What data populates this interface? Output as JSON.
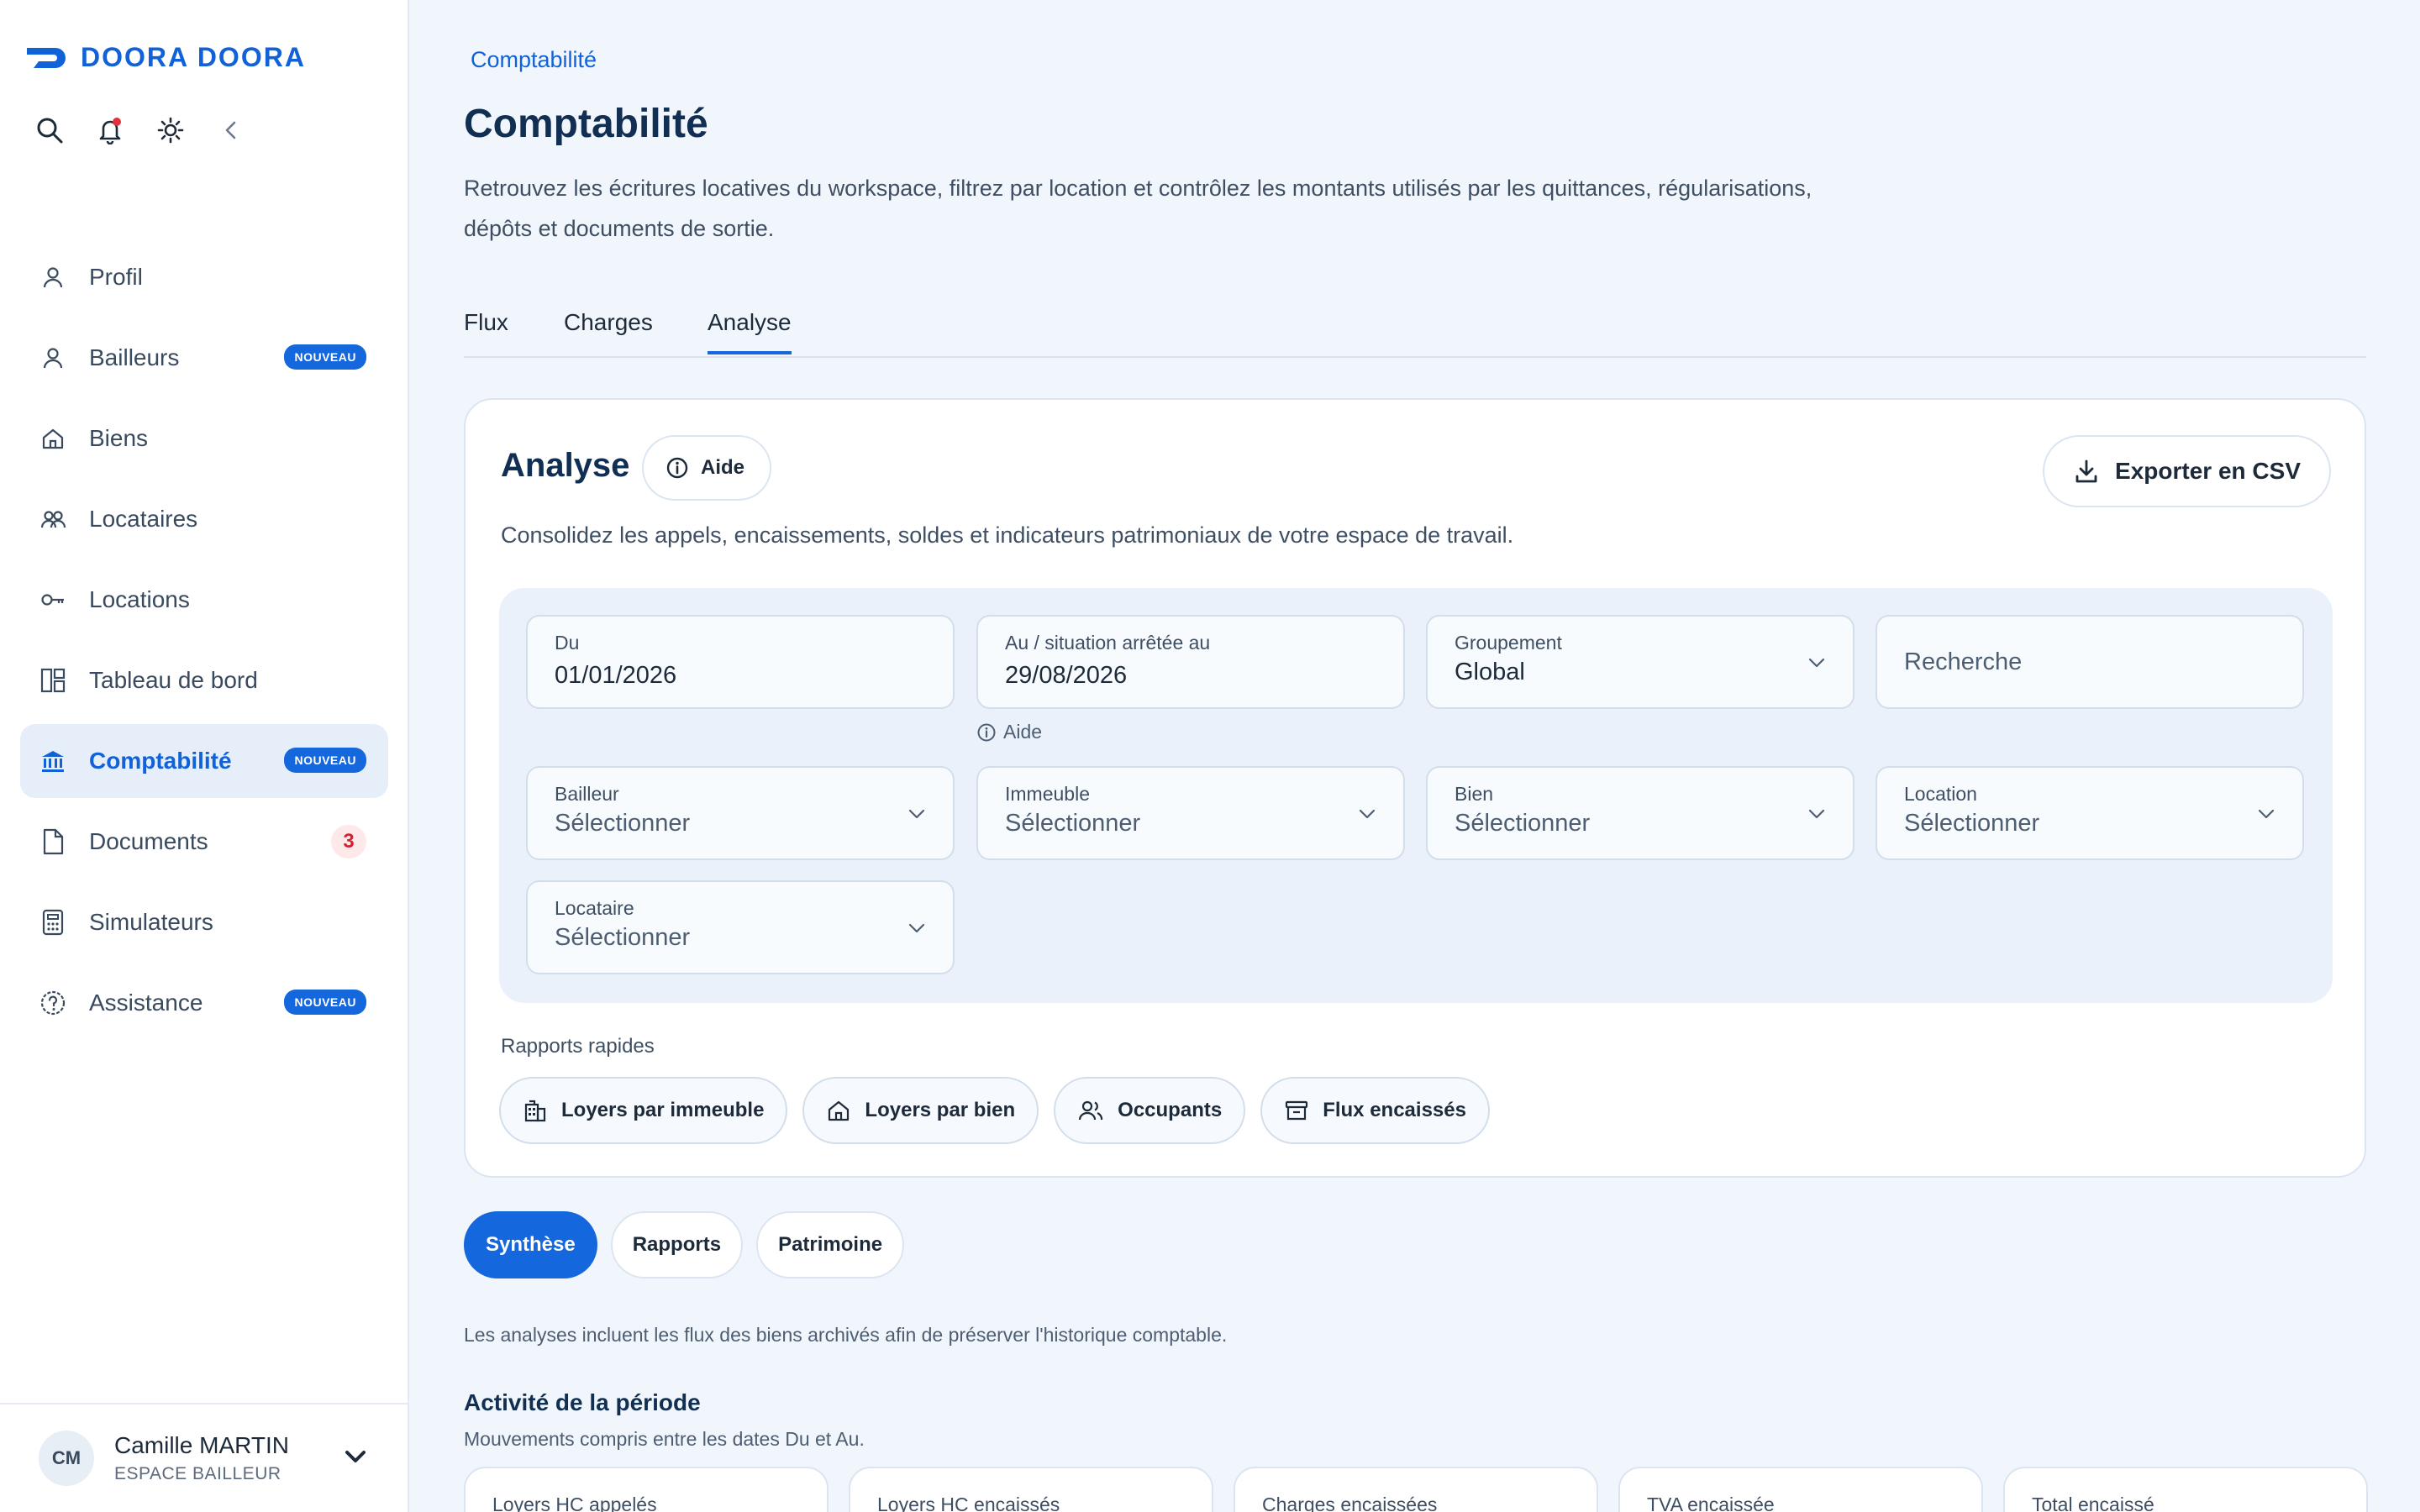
{
  "brand": {
    "name": "DOORA DOORA",
    "accent": "#1467dc"
  },
  "top_icons": [
    "search-icon",
    "bell-icon",
    "sun-icon",
    "chevron-left-icon"
  ],
  "sidebar": {
    "items": [
      {
        "label": "Profil",
        "icon": "user-icon"
      },
      {
        "label": "Bailleurs",
        "icon": "user-icon",
        "badge": "NOUVEAU"
      },
      {
        "label": "Biens",
        "icon": "home-icon"
      },
      {
        "label": "Locataires",
        "icon": "users-icon"
      },
      {
        "label": "Locations",
        "icon": "key-icon"
      },
      {
        "label": "Tableau de bord",
        "icon": "dashboard-icon"
      },
      {
        "label": "Comptabilité",
        "icon": "bank-icon",
        "badge": "NOUVEAU",
        "active": true
      },
      {
        "label": "Documents",
        "icon": "document-icon",
        "count": "3"
      },
      {
        "label": "Simulateurs",
        "icon": "calculator-icon"
      },
      {
        "label": "Assistance",
        "icon": "help-icon",
        "badge": "NOUVEAU"
      }
    ]
  },
  "user": {
    "initials": "CM",
    "name": "Camille MARTIN",
    "role": "ESPACE BAILLEUR"
  },
  "breadcrumb": "Comptabilité",
  "page": {
    "title": "Comptabilité",
    "description": "Retrouvez les écritures locatives du workspace, filtrez par location et contrôlez les montants utilisés par les quittances, régularisations, dépôts et documents de sortie."
  },
  "tabs": [
    "Flux",
    "Charges",
    "Analyse"
  ],
  "analyse": {
    "title": "Analyse",
    "help_label": "Aide",
    "export_label": "Exporter en CSV",
    "description": "Consolidez les appels, encaissements, soldes et indicateurs patrimoniaux de votre espace de travail.",
    "filters": {
      "du": {
        "label": "Du",
        "value": "01/01/2026"
      },
      "au": {
        "label": "Au / situation arrêtée au",
        "value": "29/08/2026",
        "help": "Aide"
      },
      "groupement": {
        "label": "Groupement",
        "value": "Global"
      },
      "recherche": {
        "placeholder": "Recherche"
      },
      "bailleur": {
        "label": "Bailleur",
        "value": "Sélectionner"
      },
      "immeuble": {
        "label": "Immeuble",
        "value": "Sélectionner"
      },
      "bien": {
        "label": "Bien",
        "value": "Sélectionner"
      },
      "location": {
        "label": "Location",
        "value": "Sélectionner"
      },
      "locataire": {
        "label": "Locataire",
        "value": "Sélectionner"
      }
    },
    "quick_reports_label": "Rapports rapides",
    "quick_reports": [
      {
        "label": "Loyers par immeuble",
        "icon": "building-icon"
      },
      {
        "label": "Loyers par bien",
        "icon": "home-icon"
      },
      {
        "label": "Occupants",
        "icon": "users-icon"
      },
      {
        "label": "Flux encaissés",
        "icon": "cash-icon"
      }
    ]
  },
  "subtabs": [
    "Synthèse",
    "Rapports",
    "Patrimoine"
  ],
  "note": "Les analyses incluent les flux des biens archivés afin de préserver l'historique comptable.",
  "activity": {
    "title": "Activité de la période",
    "subtitle": "Mouvements compris entre les dates Du et Au.",
    "cards": [
      "Loyers HC appelés",
      "Loyers HC encaissés",
      "Charges encaissées",
      "TVA encaissée",
      "Total encaissé"
    ]
  }
}
